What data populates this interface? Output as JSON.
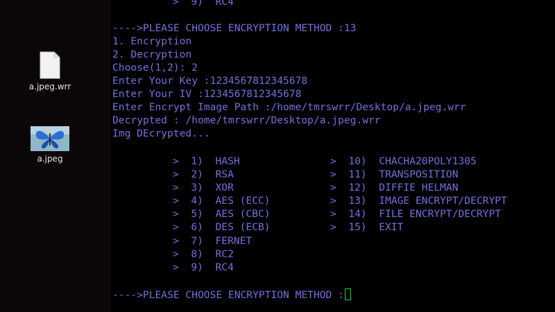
{
  "desktop": {
    "icons": [
      {
        "label": "a.jpeg.wrr",
        "icon": "document-file-icon"
      },
      {
        "label": "a.jpeg",
        "icon": "butterfly-image-thumbnail"
      }
    ]
  },
  "terminal": {
    "top_partial": ">  9)  RC4",
    "output_lines": [
      "---->PLEASE CHOOSE ENCRYPTION METHOD :13",
      "1. Encryption",
      "2. Decryption",
      "Choose(1,2): 2",
      "Enter Your Key :1234567812345678",
      "Enter Your IV :1234567812345678",
      "Enter Encrypt Image Path :/home/tmrswrr/Desktop/a.jpeg.wrr",
      "Decrypted : /home/tmrswrr/Desktop/a.jpeg.wrr",
      "Img DEcrypted..."
    ],
    "menu_left": [
      ">  1)  HASH",
      ">  2)  RSA",
      ">  3)  XOR",
      ">  4)  AES (ECC)",
      ">  5)  AES (CBC)",
      ">  6)  DES (ECB)",
      ">  7)  FERNET",
      ">  8)  RC2",
      ">  9)  RC4"
    ],
    "menu_right": [
      ">  10)  CHACHA20POLY1305",
      ">  11)  TRANSPOSITION",
      ">  12)  DIFFIE HELMAN",
      ">  13)  IMAGE ENCRYPT/DECRYPT",
      ">  14)  FILE ENCRYPT/DECRYPT",
      ">  15)  EXIT"
    ],
    "final_prompt": "---->PLEASE CHOOSE ENCRYPTION METHOD :",
    "colors": {
      "text": "#7571d8",
      "cursor": "#28d24a",
      "background": "#000000"
    }
  }
}
